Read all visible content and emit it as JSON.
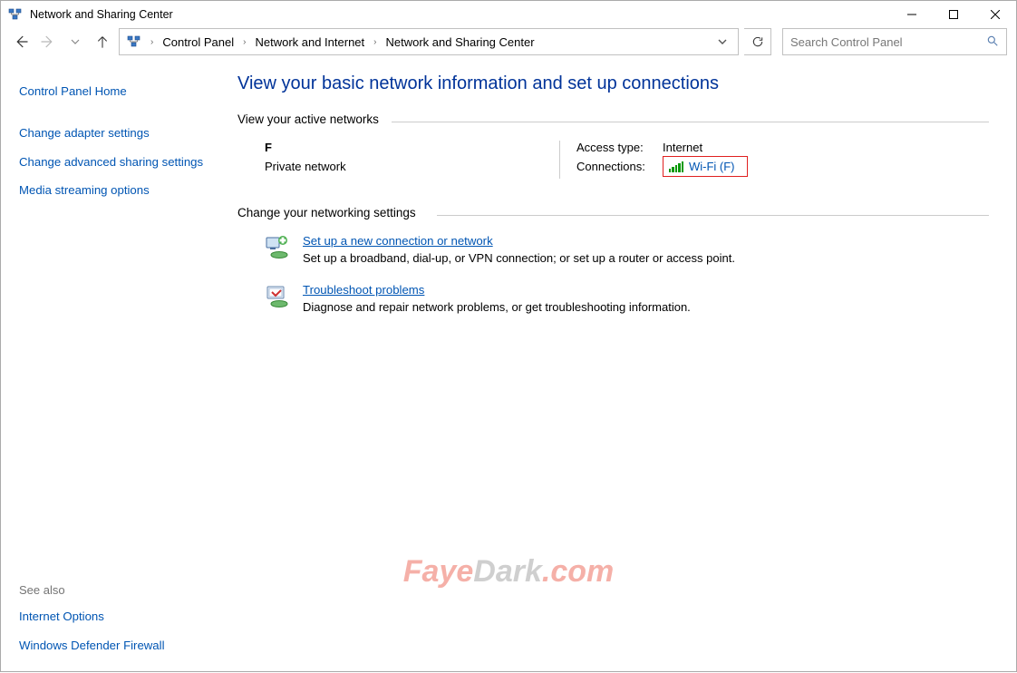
{
  "titlebar": {
    "title": "Network and Sharing Center"
  },
  "breadcrumbs": {
    "items": [
      "Control Panel",
      "Network and Internet",
      "Network and Sharing Center"
    ]
  },
  "search": {
    "placeholder": "Search Control Panel"
  },
  "sidebar": {
    "home": "Control Panel Home",
    "links": [
      "Change adapter settings",
      "Change advanced sharing settings",
      "Media streaming options"
    ],
    "see_also_title": "See also",
    "see_also": [
      "Internet Options",
      "Windows Defender Firewall"
    ]
  },
  "content": {
    "heading": "View your basic network information and set up connections",
    "section_active": "View your active networks",
    "network": {
      "name": "F",
      "type": "Private network",
      "access_label": "Access type:",
      "access_value": "Internet",
      "conn_label": "Connections:",
      "conn_value": "Wi-Fi (F)"
    },
    "section_change": "Change your networking settings",
    "setup": {
      "title": "Set up a new connection or network",
      "desc": "Set up a broadband, dial-up, or VPN connection; or set up a router or access point."
    },
    "troubleshoot": {
      "title": "Troubleshoot problems",
      "desc": "Diagnose and repair network problems, or get troubleshooting information."
    }
  },
  "watermark": {
    "p1": "Faye",
    "p2": "Dark",
    "p3": ".com"
  }
}
